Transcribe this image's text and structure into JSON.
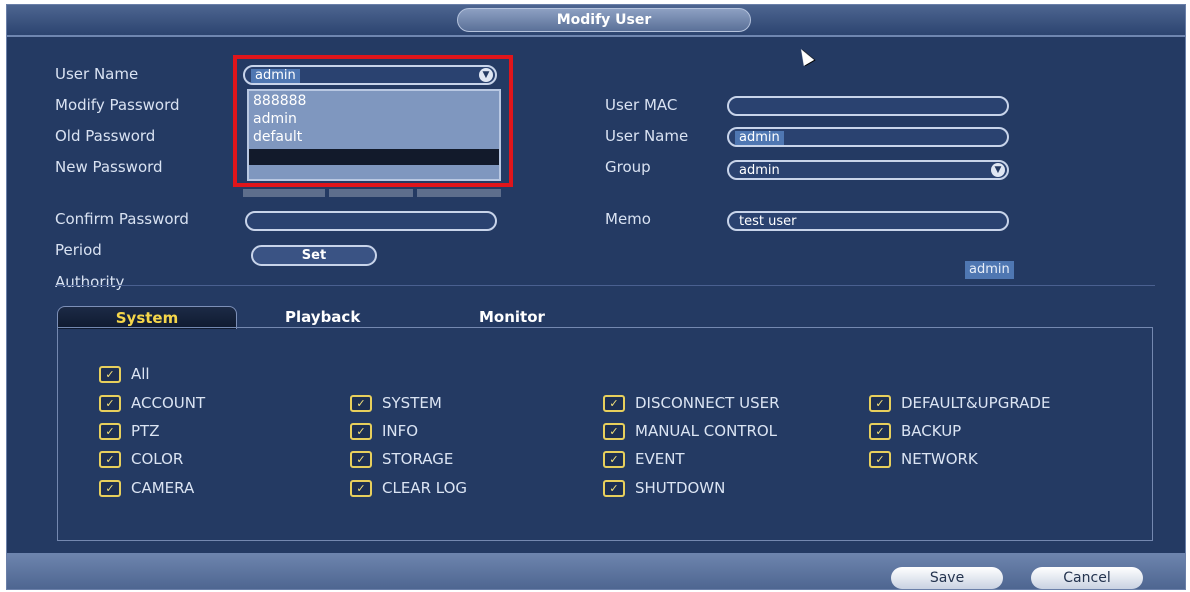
{
  "dialog": {
    "title": "Modify User"
  },
  "left_form": {
    "user_name_label": "User Name",
    "user_name_value": "admin",
    "modify_password_label": "Modify Password",
    "old_password_label": "Old Password",
    "new_password_label": "New Password",
    "confirm_password_label": "Confirm Password",
    "period_label": "Period",
    "set_button": "Set",
    "authority_label": "Authority"
  },
  "dropdown": {
    "options": [
      "888888",
      "admin",
      "default"
    ]
  },
  "right_form": {
    "user_mac_label": "User MAC",
    "user_mac_value": "",
    "user_name_label": "User Name",
    "user_name_value": "admin",
    "group_label": "Group",
    "group_value": "admin",
    "memo_label": "Memo",
    "memo_value": "test user",
    "admin_tag": "admin"
  },
  "tabs": [
    "System",
    "Playback",
    "Monitor"
  ],
  "permissions": {
    "all": "All",
    "col1": [
      "ACCOUNT",
      "PTZ",
      "COLOR",
      "CAMERA"
    ],
    "col2": [
      "SYSTEM",
      "INFO",
      "STORAGE",
      "CLEAR LOG"
    ],
    "col3": [
      "DISCONNECT USER",
      "MANUAL CONTROL",
      "EVENT",
      "SHUTDOWN"
    ],
    "col4": [
      "DEFAULT&UPGRADE",
      "BACKUP",
      "NETWORK"
    ]
  },
  "footer": {
    "save": "Save",
    "cancel": "Cancel"
  },
  "colors": {
    "background": "#243a63",
    "highlight": "#e0151b",
    "checkbox": "#e7cf5c"
  },
  "icons": {
    "checkbox": "check-icon",
    "dropdown": "chevron-down-icon",
    "cursor": "mouse-pointer-icon"
  }
}
